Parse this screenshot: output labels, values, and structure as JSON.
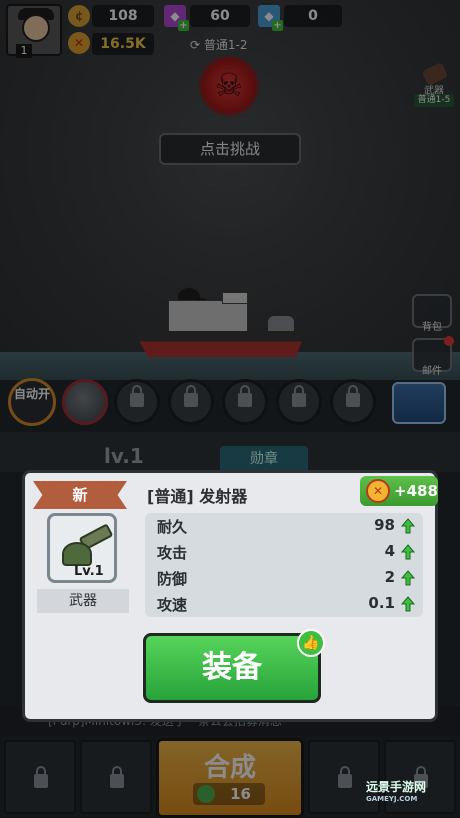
{
  "hud": {
    "player_level": "1",
    "gold": "108",
    "gems": "60",
    "crystals": "0",
    "power": "16.5K",
    "stage": "普通1-2",
    "challenge_button": "点击挑战",
    "weapon_shortcut_label": "武器",
    "weapon_shortcut_stage": "普通1-5",
    "backpack_label": "背包",
    "mail_label": "邮件"
  },
  "slots": {
    "auto_label": "自动开"
  },
  "underlay": {
    "level": "lv.1",
    "tab": "勋章",
    "chat": "[Purp]Minitowi3: 发送了一条公会招募消息",
    "merge_label": "合成",
    "merge_cost": "16"
  },
  "modal": {
    "badge": "新",
    "title": "[普通] 发射器",
    "power_delta": "+488",
    "item_level": "Lv.1",
    "item_type": "武器",
    "stats": [
      {
        "name": "耐久",
        "value": "98"
      },
      {
        "name": "攻击",
        "value": "4"
      },
      {
        "name": "防御",
        "value": "2"
      },
      {
        "name": "攻速",
        "value": "0.1"
      }
    ],
    "equip_button": "装备"
  },
  "watermark": {
    "text": "远景手游网",
    "sub": "GAMEYJ.COM"
  },
  "colors": {
    "equip_green": "#2ea83a",
    "badge_orange": "#b35d3f",
    "boss_red": "#d32a2a"
  }
}
